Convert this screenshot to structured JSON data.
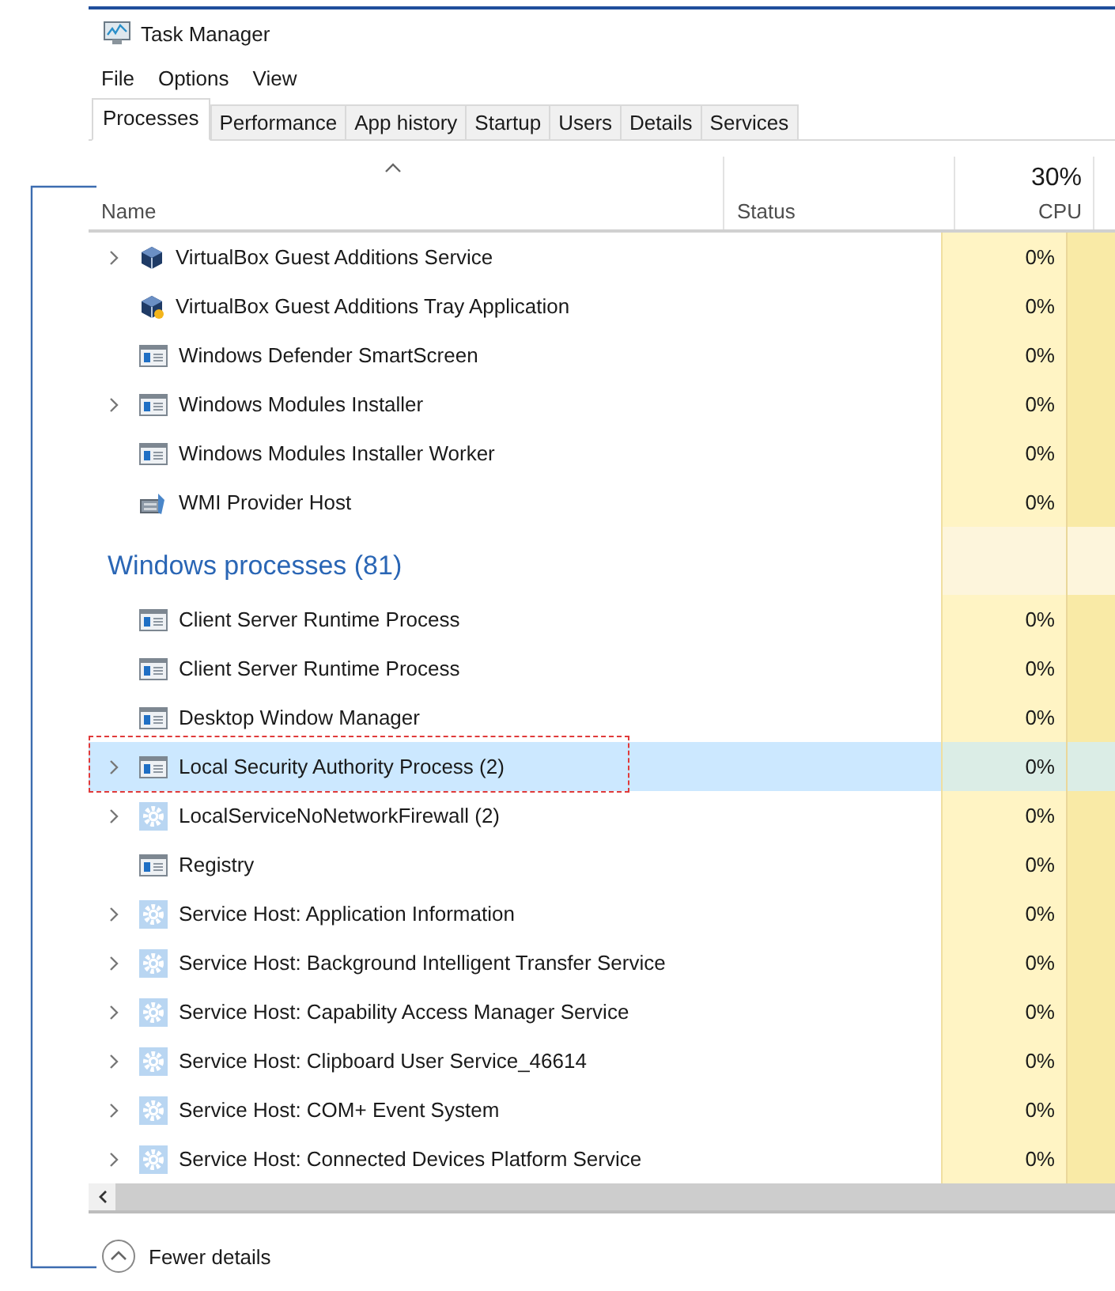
{
  "window": {
    "title": "Task Manager"
  },
  "menu": [
    "File",
    "Options",
    "View"
  ],
  "tabs": [
    {
      "label": "Processes",
      "selected": true
    },
    {
      "label": "Performance",
      "selected": false
    },
    {
      "label": "App history",
      "selected": false
    },
    {
      "label": "Startup",
      "selected": false
    },
    {
      "label": "Users",
      "selected": false
    },
    {
      "label": "Details",
      "selected": false
    },
    {
      "label": "Services",
      "selected": false
    }
  ],
  "columns": {
    "name": "Name",
    "status": "Status",
    "cpu_total": "30%",
    "cpu": "CPU"
  },
  "rows": [
    {
      "kind": "vbox",
      "name": "VirtualBox Guest Additions Service",
      "expandable": true,
      "cpu": "0%",
      "selected": false,
      "highlighted": false
    },
    {
      "kind": "vbox-tray",
      "name": "VirtualBox Guest Additions Tray Application",
      "expandable": false,
      "cpu": "0%",
      "selected": false,
      "highlighted": false
    },
    {
      "kind": "app",
      "name": "Windows Defender SmartScreen",
      "expandable": false,
      "cpu": "0%",
      "selected": false,
      "highlighted": false
    },
    {
      "kind": "app",
      "name": "Windows Modules Installer",
      "expandable": true,
      "cpu": "0%",
      "selected": false,
      "highlighted": false
    },
    {
      "kind": "app",
      "name": "Windows Modules Installer Worker",
      "expandable": false,
      "cpu": "0%",
      "selected": false,
      "highlighted": false
    },
    {
      "kind": "wmi",
      "name": "WMI Provider Host",
      "expandable": false,
      "cpu": "0%",
      "selected": false,
      "highlighted": false
    },
    {
      "kind": "group",
      "name": "Windows processes (81)"
    },
    {
      "kind": "app",
      "name": "Client Server Runtime Process",
      "expandable": false,
      "cpu": "0%",
      "selected": false,
      "highlighted": false
    },
    {
      "kind": "app",
      "name": "Client Server Runtime Process",
      "expandable": false,
      "cpu": "0%",
      "selected": false,
      "highlighted": false
    },
    {
      "kind": "app",
      "name": "Desktop Window Manager",
      "expandable": false,
      "cpu": "0%",
      "selected": false,
      "highlighted": false
    },
    {
      "kind": "app",
      "name": "Local Security Authority Process (2)",
      "expandable": true,
      "cpu": "0%",
      "selected": true,
      "highlighted": true
    },
    {
      "kind": "service",
      "name": "LocalServiceNoNetworkFirewall (2)",
      "expandable": true,
      "cpu": "0%",
      "selected": false,
      "highlighted": false
    },
    {
      "kind": "app",
      "name": "Registry",
      "expandable": false,
      "cpu": "0%",
      "selected": false,
      "highlighted": false
    },
    {
      "kind": "service",
      "name": "Service Host: Application Information",
      "expandable": true,
      "cpu": "0%",
      "selected": false,
      "highlighted": false
    },
    {
      "kind": "service",
      "name": "Service Host: Background Intelligent Transfer Service",
      "expandable": true,
      "cpu": "0%",
      "selected": false,
      "highlighted": false
    },
    {
      "kind": "service",
      "name": "Service Host: Capability Access Manager Service",
      "expandable": true,
      "cpu": "0%",
      "selected": false,
      "highlighted": false
    },
    {
      "kind": "service",
      "name": "Service Host: Clipboard User Service_46614",
      "expandable": true,
      "cpu": "0%",
      "selected": false,
      "highlighted": false
    },
    {
      "kind": "service",
      "name": "Service Host: COM+ Event System",
      "expandable": true,
      "cpu": "0%",
      "selected": false,
      "highlighted": false
    },
    {
      "kind": "service",
      "name": "Service Host: Connected Devices Platform Service",
      "expandable": true,
      "cpu": "0%",
      "selected": false,
      "highlighted": false
    }
  ],
  "footer": {
    "label": "Fewer details"
  }
}
